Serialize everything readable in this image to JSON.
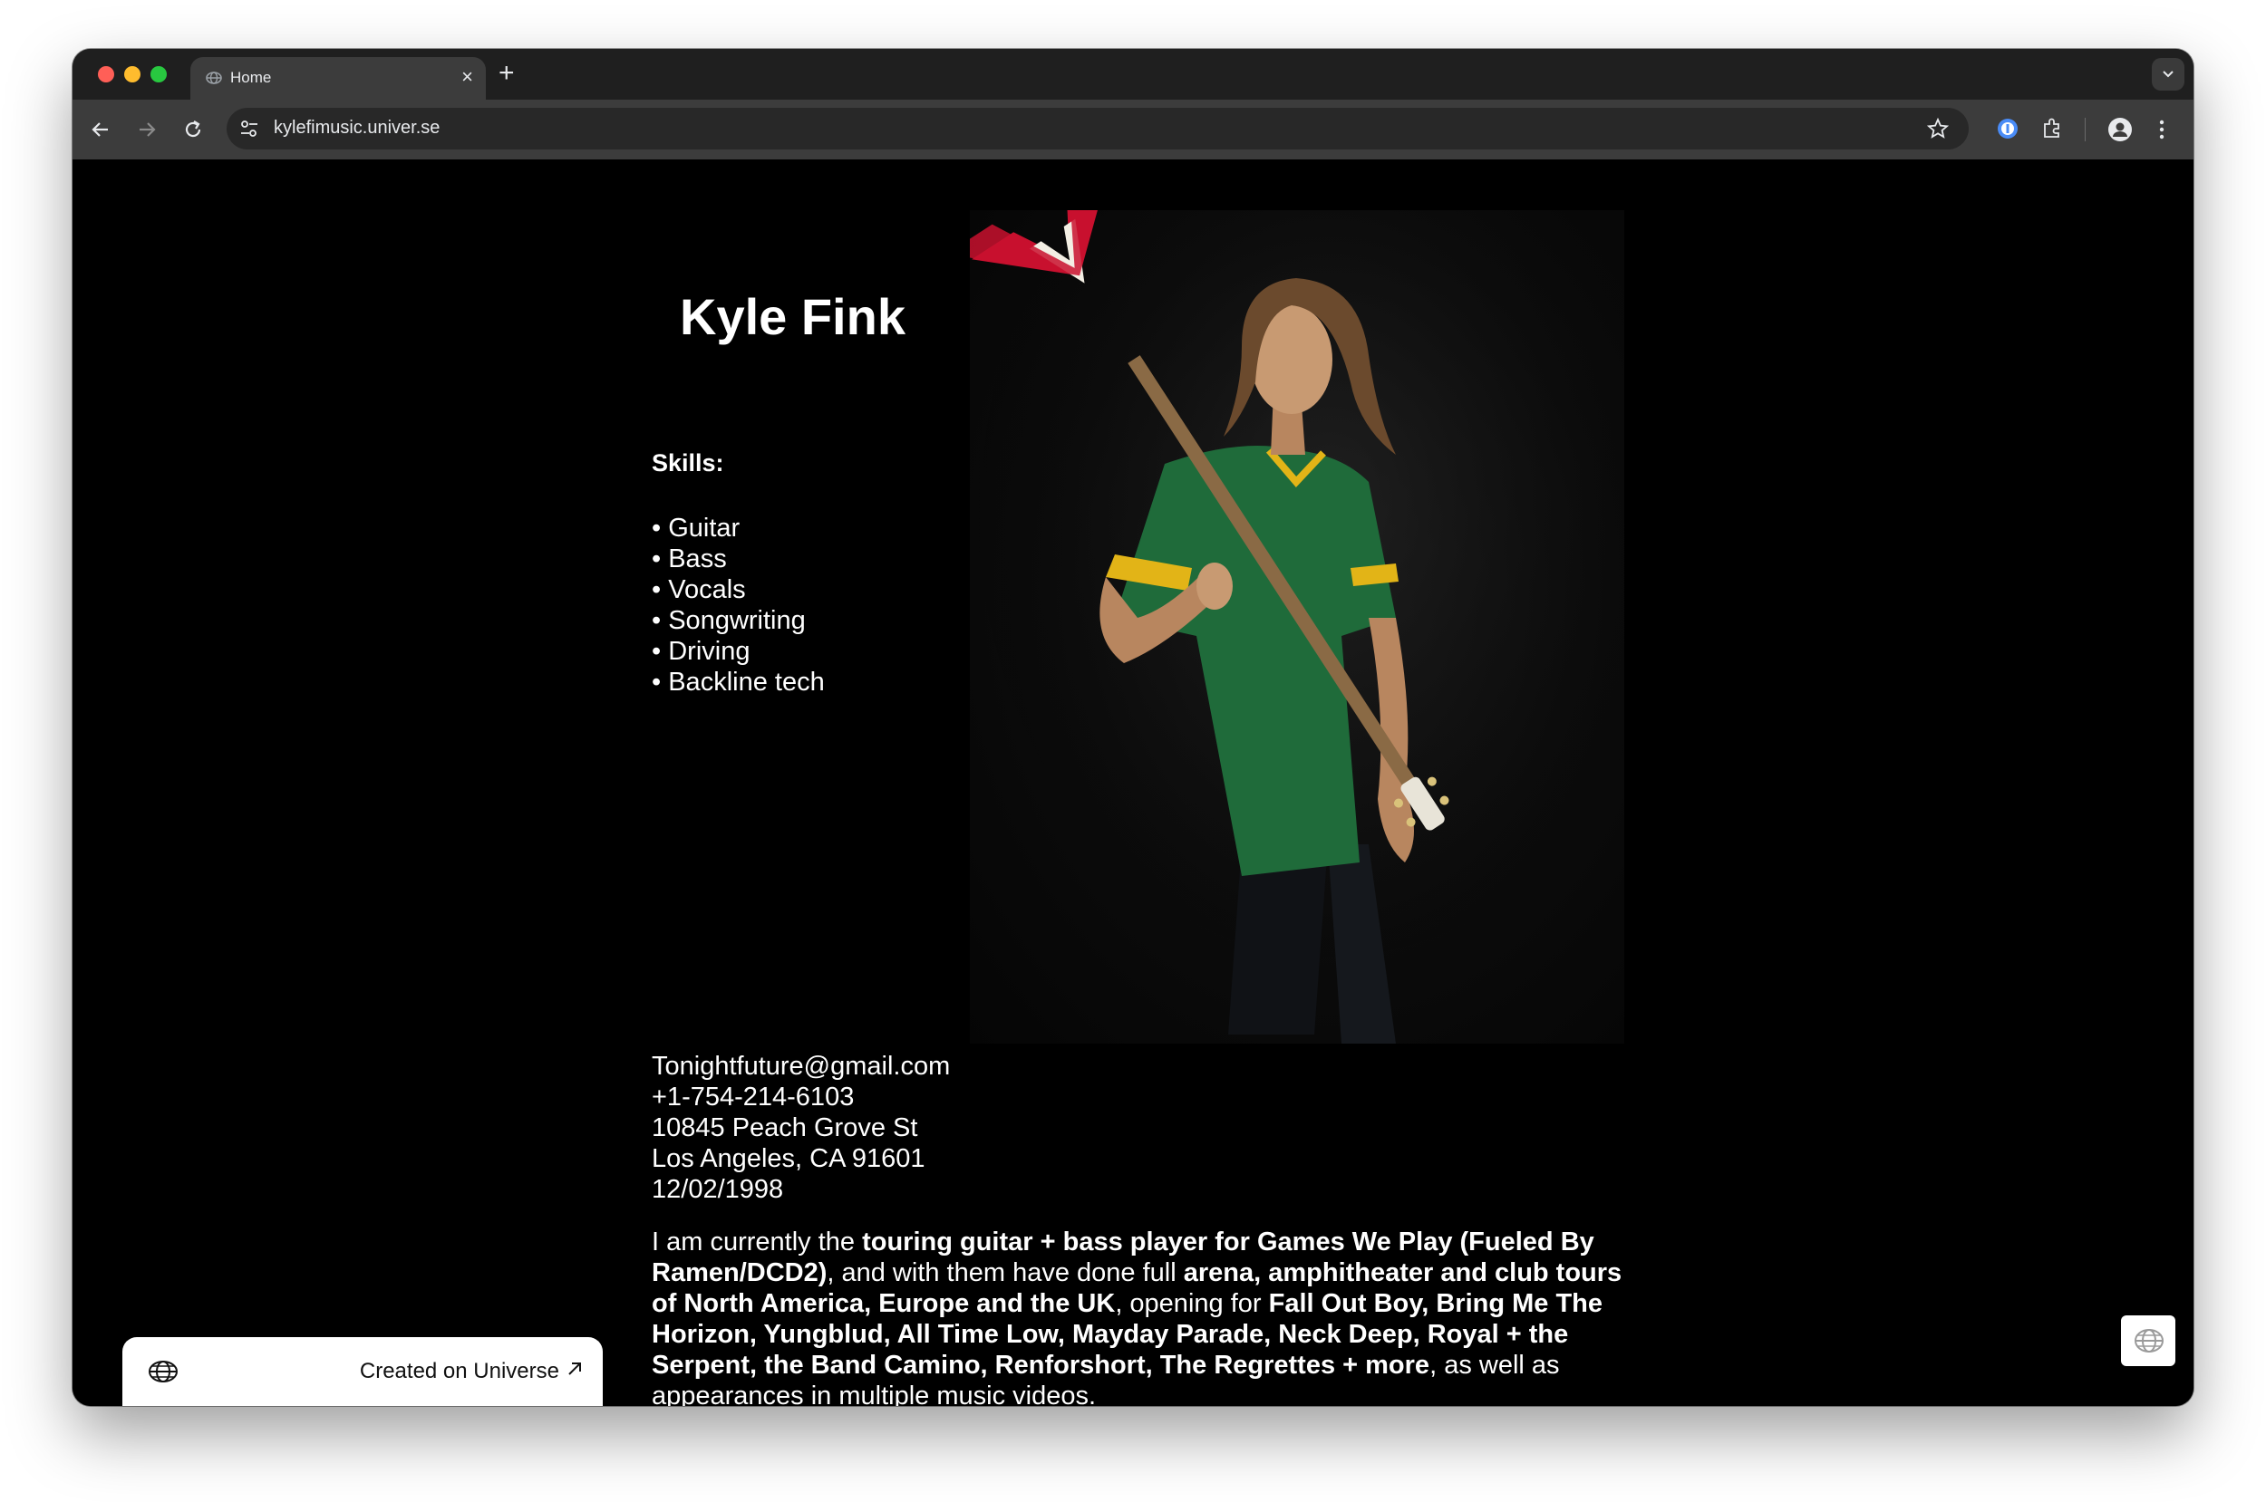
{
  "browser": {
    "tab_title": "Home",
    "new_tab_label": "+",
    "close_label": "×",
    "url": "kylefimusic.univer.se"
  },
  "profile": {
    "name": "Kyle Fink",
    "skills_heading": "Skills:",
    "skills": [
      "Guitar",
      "Bass",
      "Vocals",
      "Songwriting",
      "Driving",
      "Backline tech"
    ]
  },
  "contact": {
    "email": "Tonightfuture@gmail.com",
    "phone": "+1-754-214-6103",
    "address_line1": "10845 Peach Grove St",
    "address_line2": "Los Angeles, CA 91601",
    "date": "12/02/1998"
  },
  "bio": {
    "p1": "I am currently the ",
    "b1": "touring guitar + bass player for Games We Play (Fueled By Ramen/DCD2)",
    "p2": ", and with them have done full ",
    "b2": "arena, amphitheater and club tours of North America, Europe and the UK",
    "p3": ", opening for ",
    "b3": "Fall Out Boy, Bring Me The Horizon, Yungblud, All Time Low, Mayday Parade, Neck Deep, Royal + the Serpent, the Band Camino, Renforshort, The Regrettes + more",
    "p4": ", as well as appearances in multiple music videos."
  },
  "badge": {
    "label": "Created on Universe",
    "icon": "globe-icon",
    "arrow_icon": "arrow-up-right-icon"
  },
  "colors": {
    "page_bg": "#000000",
    "text": "#ffffff",
    "chrome_tabbar": "#1f1f1f",
    "chrome_toolbar": "#3c3c3c",
    "guitar_red": "#c8102e",
    "jersey_green": "#1f6b3a"
  }
}
